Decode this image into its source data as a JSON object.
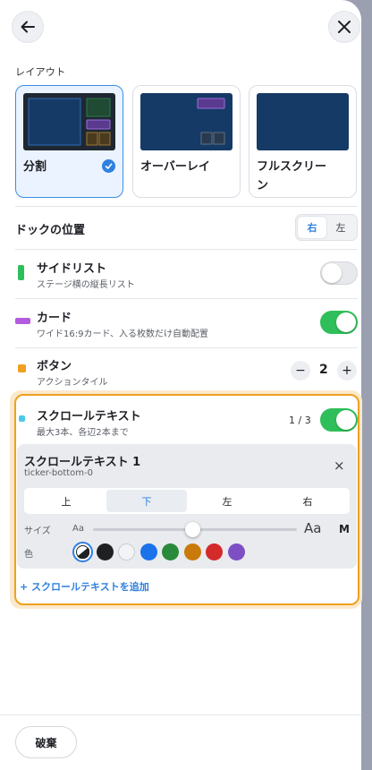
{
  "layout": {
    "section_label": "レイアウト",
    "options": [
      {
        "label": "分割",
        "selected": true
      },
      {
        "label": "オーバーレイ",
        "selected": false
      },
      {
        "label": "フルスクリーン",
        "selected": false
      }
    ]
  },
  "dock": {
    "label": "ドックの位置",
    "options": [
      "右",
      "左"
    ],
    "selected": "右"
  },
  "rows": {
    "sidelist": {
      "title": "サイドリスト",
      "sub": "ステージ横の縦長リスト",
      "color": "#2fbf5a",
      "enabled": false
    },
    "card": {
      "title": "カード",
      "sub": "ワイド16:9カード、入る枚数だけ自動配置",
      "color": "#b35ce0",
      "enabled": true
    },
    "button": {
      "title": "ボタン",
      "sub": "アクションタイル",
      "color": "#f0a020",
      "minus": "−",
      "plus": "+",
      "value": "2"
    },
    "ticker": {
      "title": "スクロールテキスト",
      "sub": "最大3本、各辺2本まで",
      "color": "#4fc8e8",
      "count": "1 / 3",
      "enabled": true
    }
  },
  "ticker_card": {
    "title": "スクロールテキスト 1",
    "id": "ticker-bottom-0",
    "close": "×",
    "positions": [
      "上",
      "下",
      "左",
      "右"
    ],
    "selected_position": "下",
    "size_label": "サイズ",
    "size_small": "Aa",
    "size_large": "Aa",
    "size_value": "M",
    "size_level_fraction": 0.49,
    "color_label": "色",
    "colors": [
      "auto",
      "#1f2022",
      "#f2f3f5",
      "#1a73e8",
      "#2a8a3c",
      "#c97a0a",
      "#d42a2a",
      "#7d4fc4"
    ],
    "selected_color": "auto"
  },
  "add_ticker": "+ スクロールテキストを追加",
  "footer": {
    "discard": "破棄"
  }
}
